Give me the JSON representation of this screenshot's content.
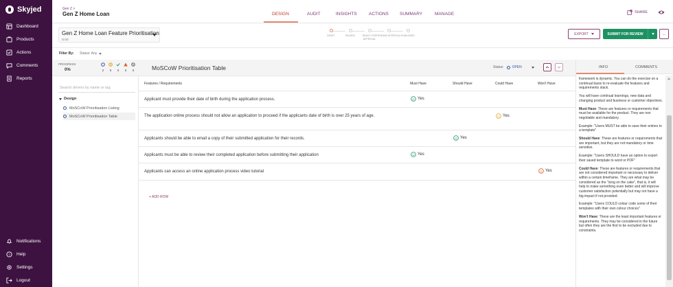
{
  "brand": {
    "name": "Skyjed"
  },
  "sidebar": {
    "items": [
      {
        "label": "Dashboard",
        "icon": "dashboard-icon"
      },
      {
        "label": "Products",
        "icon": "products-icon"
      },
      {
        "label": "Actions",
        "icon": "actions-icon"
      },
      {
        "label": "Comments",
        "icon": "comments-icon"
      },
      {
        "label": "Reports",
        "icon": "reports-icon"
      }
    ],
    "bottom_items": [
      {
        "label": "Notifications",
        "icon": "bell-icon"
      },
      {
        "label": "Help",
        "icon": "help-icon"
      },
      {
        "label": "Settings",
        "icon": "gear-icon"
      },
      {
        "label": "Logout",
        "icon": "logout-icon"
      }
    ]
  },
  "header": {
    "breadcrumb": "Gen Z >",
    "title": "Gen Z Home Loan",
    "tabs": [
      "DESIGN",
      "AUDIT",
      "INSIGHTS",
      "ACTIONS",
      "SUMMARY",
      "MANAGE"
    ],
    "active_tab": "DESIGN",
    "share_label": "SHARE"
  },
  "subheader": {
    "document_title": "Gen Z Home Loan Feature Prioritisation",
    "document_status": "Draft",
    "workflow_steps": [
      "DRAFT",
      "PAUSED",
      "READY FOR APPROVAL",
      "PENDING APPROVAL",
      "PUBLISHED"
    ],
    "export_label": "EXPORT",
    "submit_label": "SUBMIT FOR REVIEW",
    "more_label": "..."
  },
  "filter": {
    "label": "Filter By:",
    "status": "Status: Any"
  },
  "progress": {
    "label": "PROGRESS",
    "value": "0%",
    "counts": [
      {
        "icon": "open-circle-icon",
        "count": "2",
        "color": "#3a55a0"
      },
      {
        "icon": "clock-icon",
        "count": "0",
        "color": "#e0a020"
      },
      {
        "icon": "check-icon",
        "count": "0",
        "color": "#1e9163"
      },
      {
        "icon": "warning-icon",
        "count": "0",
        "color": "#e05a20"
      },
      {
        "icon": "blocked-icon",
        "count": "0",
        "color": "#666666"
      }
    ]
  },
  "left_panel": {
    "search_placeholder": "Search drivers by name or tag",
    "group": "Design",
    "items": [
      "MoSCoW Prioritisation Listing",
      "MoSCoW Prioritisation Table"
    ],
    "selected_index": 1
  },
  "main": {
    "title": "MoSCoW Prioritisation Table",
    "status_label": "Status:",
    "status_value": "OPEN",
    "columns": [
      "Features / Requirements",
      "Must Have",
      "Should Have",
      "Could Have",
      "Won't Have"
    ],
    "rows": [
      {
        "text": "Applicant must provide their date of birth during the application process.",
        "priority": "Must Have",
        "answer": "Yes"
      },
      {
        "text": "The application online process should not allow an application to proceed if the applicants date of birth is over 25 years of age.",
        "priority": "Could Have",
        "answer": "Yes"
      },
      {
        "text": "Applicants should be able to email a copy of their submitted application for their records.",
        "priority": "Should Have",
        "answer": "Yes"
      },
      {
        "text": "Applicants must be able to review their completed application before submitting their application",
        "priority": "Must Have",
        "answer": "Yes"
      },
      {
        "text": "Applicants can access an online application process video tutorial",
        "priority": "Won't Have",
        "answer": "Yes"
      }
    ],
    "add_row_label": "+ ADD ROW",
    "colors": {
      "Must Have": "#1e9163",
      "Should Have": "#1e9163",
      "Could Have": "#e0a020",
      "Won't Have": "#e05a20"
    }
  },
  "right_panel": {
    "tabs": [
      "INFO",
      "COMMENTS"
    ],
    "active_tab": "INFO",
    "paragraphs": [
      {
        "bold": "",
        "text": "framework is dynamic.  You can do the exercise on a continual basis to re-evaluate the features and requirements stack."
      },
      {
        "bold": "",
        "text": "You will have continual learnings, new data and changing product and business or customer objectives."
      },
      {
        "bold": "Must Have",
        "text": ": These are features or requirements that must be available for the product. They are non negotiable and mandatory."
      },
      {
        "bold": "",
        "text": "Example: \"Users MUST be able to save their entries to a template\""
      },
      {
        "bold": "Should Have",
        "text": ": These are features or requirements that are important, but they are not mandatory or time sensitive."
      },
      {
        "bold": "",
        "text": "Example: \"Users SHOULD have an option to export their saved template to word or PDF\""
      },
      {
        "bold": "Could Have",
        "text": ": These are features or requirements that are not considered important or necessary to deliver within a certain timeframe.  They are what may be considered as the \"icing on the cake\", that is, it will help to make something even better and will improve customer satisfaction potentially but may not have a big impact if not provided."
      },
      {
        "bold": "",
        "text": "Example: \"Users COULD colour code some of their templates with their own colour choices\""
      },
      {
        "bold": "Won't Have",
        "text": ": These are the least important features or requirements. They may be considered in the future but often they are the first to be excluded due to constraints."
      }
    ]
  },
  "theme": {
    "sidebar": "#3d1240",
    "accent": "#8b3d6b",
    "primary_green": "#1e9163",
    "tab_active": "#e28b72"
  }
}
